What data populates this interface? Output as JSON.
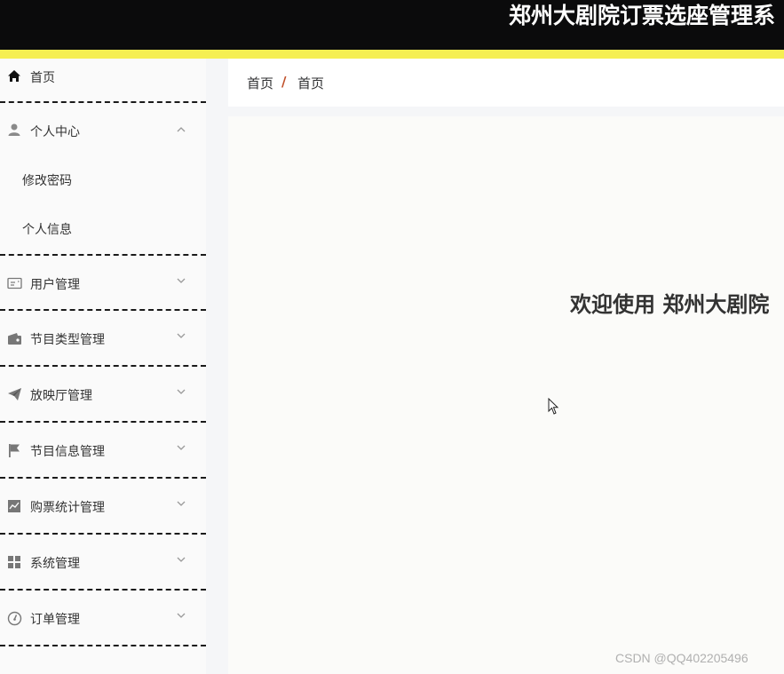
{
  "header": {
    "title": "郑州大剧院订票选座管理系"
  },
  "sidebar": {
    "items": [
      {
        "label": "首页",
        "icon": "home-icon"
      },
      {
        "label": "个人中心",
        "icon": "user-icon",
        "expanded": true,
        "children": [
          {
            "label": "修改密码"
          },
          {
            "label": "个人信息"
          }
        ]
      },
      {
        "label": "用户管理",
        "icon": "id-card-icon"
      },
      {
        "label": "节目类型管理",
        "icon": "wallet-icon"
      },
      {
        "label": "放映厅管理",
        "icon": "send-icon"
      },
      {
        "label": "节目信息管理",
        "icon": "flag-icon"
      },
      {
        "label": "购票统计管理",
        "icon": "chart-icon"
      },
      {
        "label": "系统管理",
        "icon": "grid-icon"
      },
      {
        "label": "订单管理",
        "icon": "gauge-icon"
      }
    ]
  },
  "breadcrumb": {
    "items": [
      "首页",
      "首页"
    ],
    "separator": "/"
  },
  "main": {
    "welcome_text": "欢迎使用 郑州大剧院"
  },
  "watermark": "CSDN @QQ402205496",
  "colors": {
    "topbar": "#0b0b0c",
    "accent": "#f5ef52",
    "breadcrumb_separator": "#c0502a"
  }
}
